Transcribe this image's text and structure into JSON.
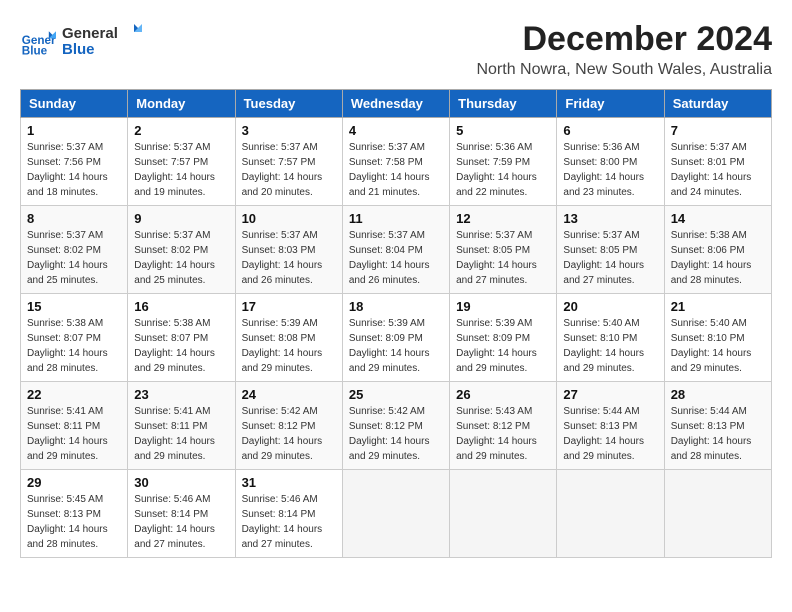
{
  "logo": {
    "line1": "General",
    "line2": "Blue"
  },
  "title": "December 2024",
  "location": "North Nowra, New South Wales, Australia",
  "weekdays": [
    "Sunday",
    "Monday",
    "Tuesday",
    "Wednesday",
    "Thursday",
    "Friday",
    "Saturday"
  ],
  "weeks": [
    [
      {
        "day": "1",
        "info": "Sunrise: 5:37 AM\nSunset: 7:56 PM\nDaylight: 14 hours\nand 18 minutes."
      },
      {
        "day": "2",
        "info": "Sunrise: 5:37 AM\nSunset: 7:57 PM\nDaylight: 14 hours\nand 19 minutes."
      },
      {
        "day": "3",
        "info": "Sunrise: 5:37 AM\nSunset: 7:57 PM\nDaylight: 14 hours\nand 20 minutes."
      },
      {
        "day": "4",
        "info": "Sunrise: 5:37 AM\nSunset: 7:58 PM\nDaylight: 14 hours\nand 21 minutes."
      },
      {
        "day": "5",
        "info": "Sunrise: 5:36 AM\nSunset: 7:59 PM\nDaylight: 14 hours\nand 22 minutes."
      },
      {
        "day": "6",
        "info": "Sunrise: 5:36 AM\nSunset: 8:00 PM\nDaylight: 14 hours\nand 23 minutes."
      },
      {
        "day": "7",
        "info": "Sunrise: 5:37 AM\nSunset: 8:01 PM\nDaylight: 14 hours\nand 24 minutes."
      }
    ],
    [
      {
        "day": "8",
        "info": "Sunrise: 5:37 AM\nSunset: 8:02 PM\nDaylight: 14 hours\nand 25 minutes."
      },
      {
        "day": "9",
        "info": "Sunrise: 5:37 AM\nSunset: 8:02 PM\nDaylight: 14 hours\nand 25 minutes."
      },
      {
        "day": "10",
        "info": "Sunrise: 5:37 AM\nSunset: 8:03 PM\nDaylight: 14 hours\nand 26 minutes."
      },
      {
        "day": "11",
        "info": "Sunrise: 5:37 AM\nSunset: 8:04 PM\nDaylight: 14 hours\nand 26 minutes."
      },
      {
        "day": "12",
        "info": "Sunrise: 5:37 AM\nSunset: 8:05 PM\nDaylight: 14 hours\nand 27 minutes."
      },
      {
        "day": "13",
        "info": "Sunrise: 5:37 AM\nSunset: 8:05 PM\nDaylight: 14 hours\nand 27 minutes."
      },
      {
        "day": "14",
        "info": "Sunrise: 5:38 AM\nSunset: 8:06 PM\nDaylight: 14 hours\nand 28 minutes."
      }
    ],
    [
      {
        "day": "15",
        "info": "Sunrise: 5:38 AM\nSunset: 8:07 PM\nDaylight: 14 hours\nand 28 minutes."
      },
      {
        "day": "16",
        "info": "Sunrise: 5:38 AM\nSunset: 8:07 PM\nDaylight: 14 hours\nand 29 minutes."
      },
      {
        "day": "17",
        "info": "Sunrise: 5:39 AM\nSunset: 8:08 PM\nDaylight: 14 hours\nand 29 minutes."
      },
      {
        "day": "18",
        "info": "Sunrise: 5:39 AM\nSunset: 8:09 PM\nDaylight: 14 hours\nand 29 minutes."
      },
      {
        "day": "19",
        "info": "Sunrise: 5:39 AM\nSunset: 8:09 PM\nDaylight: 14 hours\nand 29 minutes."
      },
      {
        "day": "20",
        "info": "Sunrise: 5:40 AM\nSunset: 8:10 PM\nDaylight: 14 hours\nand 29 minutes."
      },
      {
        "day": "21",
        "info": "Sunrise: 5:40 AM\nSunset: 8:10 PM\nDaylight: 14 hours\nand 29 minutes."
      }
    ],
    [
      {
        "day": "22",
        "info": "Sunrise: 5:41 AM\nSunset: 8:11 PM\nDaylight: 14 hours\nand 29 minutes."
      },
      {
        "day": "23",
        "info": "Sunrise: 5:41 AM\nSunset: 8:11 PM\nDaylight: 14 hours\nand 29 minutes."
      },
      {
        "day": "24",
        "info": "Sunrise: 5:42 AM\nSunset: 8:12 PM\nDaylight: 14 hours\nand 29 minutes."
      },
      {
        "day": "25",
        "info": "Sunrise: 5:42 AM\nSunset: 8:12 PM\nDaylight: 14 hours\nand 29 minutes."
      },
      {
        "day": "26",
        "info": "Sunrise: 5:43 AM\nSunset: 8:12 PM\nDaylight: 14 hours\nand 29 minutes."
      },
      {
        "day": "27",
        "info": "Sunrise: 5:44 AM\nSunset: 8:13 PM\nDaylight: 14 hours\nand 29 minutes."
      },
      {
        "day": "28",
        "info": "Sunrise: 5:44 AM\nSunset: 8:13 PM\nDaylight: 14 hours\nand 28 minutes."
      }
    ],
    [
      {
        "day": "29",
        "info": "Sunrise: 5:45 AM\nSunset: 8:13 PM\nDaylight: 14 hours\nand 28 minutes."
      },
      {
        "day": "30",
        "info": "Sunrise: 5:46 AM\nSunset: 8:14 PM\nDaylight: 14 hours\nand 27 minutes."
      },
      {
        "day": "31",
        "info": "Sunrise: 5:46 AM\nSunset: 8:14 PM\nDaylight: 14 hours\nand 27 minutes."
      },
      {
        "day": "",
        "info": ""
      },
      {
        "day": "",
        "info": ""
      },
      {
        "day": "",
        "info": ""
      },
      {
        "day": "",
        "info": ""
      }
    ]
  ]
}
